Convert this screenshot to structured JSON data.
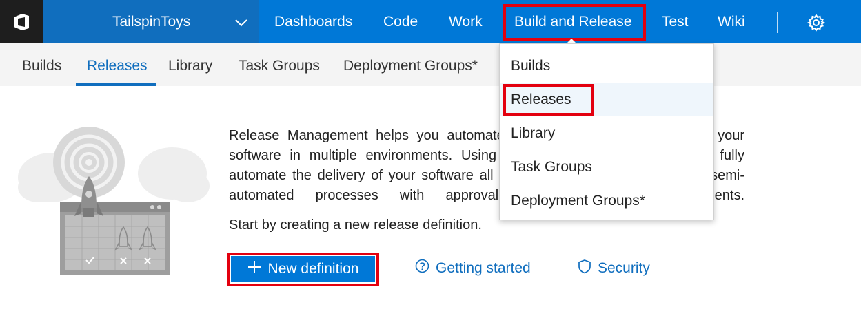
{
  "topbar": {
    "logo_icon": "vsts-logo-icon",
    "project_name": "TailspinToys",
    "project_chevron_icon": "chevron-down-icon",
    "nav": [
      "Dashboards",
      "Code",
      "Work",
      "Build and Release",
      "Test",
      "Wiki"
    ],
    "settings_icon": "gear-icon",
    "highlight_color": "#e3000f",
    "accent": "#0078d7"
  },
  "subnav": {
    "items": [
      "Builds",
      "Releases",
      "Library",
      "Task Groups",
      "Deployment Groups*"
    ],
    "active": "Releases"
  },
  "dropdown": {
    "items": [
      "Builds",
      "Releases",
      "Library",
      "Task Groups",
      "Deployment Groups*"
    ],
    "selected": "Releases"
  },
  "content": {
    "illustration_icon": "rocket-radar-illustration",
    "description": "Release Management helps you automate the deployment and testing of your software in multiple environments. Using Release Management, you can fully automate the delivery of your software all the way to production, or set up semi-automated processes with approvals and on-demand deployments.",
    "start_text": "Start by creating a new release definition.",
    "new_definition_label": "New definition",
    "new_definition_icon": "plus-icon",
    "getting_started_label": "Getting started",
    "getting_started_icon": "question-circle-icon",
    "security_label": "Security",
    "security_icon": "shield-icon"
  }
}
